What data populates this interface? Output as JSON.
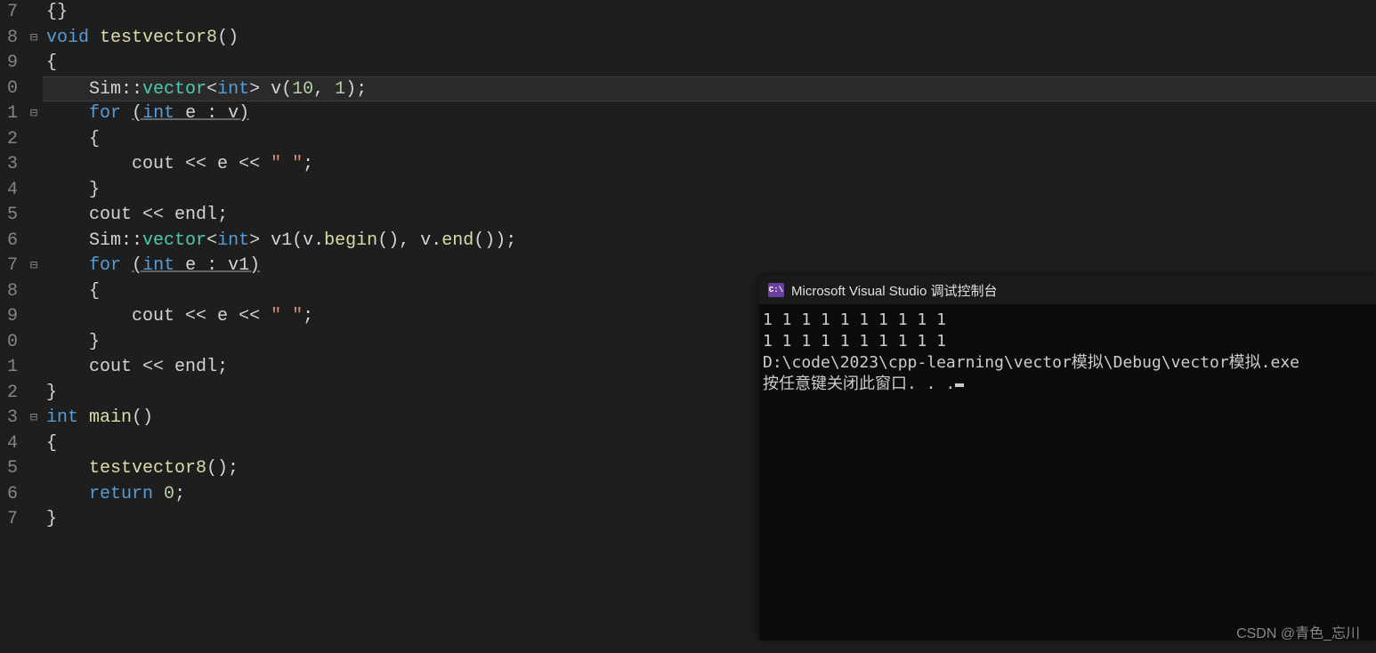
{
  "lineNumbers": [
    "7",
    "8",
    "9",
    "0",
    "1",
    "2",
    "3",
    "4",
    "5",
    "6",
    "7",
    "8",
    "9",
    "0",
    "1",
    "2",
    "3",
    "4",
    "5",
    "6",
    "7"
  ],
  "foldMarkers": [
    "",
    "⊟",
    "",
    "",
    "⊟",
    "",
    "",
    "",
    "",
    "",
    "⊟",
    "",
    "",
    "",
    "",
    "",
    "⊟",
    "",
    "",
    "",
    ""
  ],
  "code": [
    [
      {
        "t": "punct",
        "v": "{"
      },
      {
        "t": "punct",
        "v": "}"
      }
    ],
    [
      {
        "t": "kw",
        "v": "void"
      },
      {
        "t": "var",
        "v": " "
      },
      {
        "t": "fn",
        "v": "testvector8"
      },
      {
        "t": "punct",
        "v": "()"
      }
    ],
    [
      {
        "t": "punct",
        "v": "{"
      }
    ],
    [
      {
        "t": "var",
        "v": "    "
      },
      {
        "t": "var",
        "v": "Sim"
      },
      {
        "t": "punct",
        "v": "::"
      },
      {
        "t": "type",
        "v": "vector"
      },
      {
        "t": "punct",
        "v": "<"
      },
      {
        "t": "kw",
        "v": "int"
      },
      {
        "t": "punct",
        "v": "> "
      },
      {
        "t": "var",
        "v": "v"
      },
      {
        "t": "punct",
        "v": "("
      },
      {
        "t": "num",
        "v": "10"
      },
      {
        "t": "punct",
        "v": ", "
      },
      {
        "t": "num",
        "v": "1"
      },
      {
        "t": "punct",
        "v": ");"
      }
    ],
    [
      {
        "t": "var",
        "v": "    "
      },
      {
        "t": "kw",
        "v": "for"
      },
      {
        "t": "var",
        "v": " "
      },
      {
        "t": "punct paren-underline",
        "v": "("
      },
      {
        "t": "kw paren-underline",
        "v": "int"
      },
      {
        "t": "var paren-underline",
        "v": " e "
      },
      {
        "t": "punct paren-underline",
        "v": ":"
      },
      {
        "t": "var paren-underline",
        "v": " v"
      },
      {
        "t": "punct paren-underline",
        "v": ")"
      }
    ],
    [
      {
        "t": "var",
        "v": "    "
      },
      {
        "t": "punct",
        "v": "{"
      }
    ],
    [
      {
        "t": "var",
        "v": "        "
      },
      {
        "t": "var",
        "v": "cout "
      },
      {
        "t": "punct",
        "v": "<< "
      },
      {
        "t": "var",
        "v": "e "
      },
      {
        "t": "punct",
        "v": "<< "
      },
      {
        "t": "str",
        "v": "\" \""
      },
      {
        "t": "punct",
        "v": ";"
      }
    ],
    [
      {
        "t": "var",
        "v": "    "
      },
      {
        "t": "punct",
        "v": "}"
      }
    ],
    [
      {
        "t": "var",
        "v": "    "
      },
      {
        "t": "var",
        "v": "cout "
      },
      {
        "t": "punct",
        "v": "<< "
      },
      {
        "t": "var",
        "v": "endl"
      },
      {
        "t": "punct",
        "v": ";"
      }
    ],
    [
      {
        "t": "var",
        "v": "    "
      },
      {
        "t": "var",
        "v": "Sim"
      },
      {
        "t": "punct",
        "v": "::"
      },
      {
        "t": "type",
        "v": "vector"
      },
      {
        "t": "punct",
        "v": "<"
      },
      {
        "t": "kw",
        "v": "int"
      },
      {
        "t": "punct",
        "v": "> "
      },
      {
        "t": "var",
        "v": "v1"
      },
      {
        "t": "punct",
        "v": "("
      },
      {
        "t": "var",
        "v": "v"
      },
      {
        "t": "punct",
        "v": "."
      },
      {
        "t": "fn",
        "v": "begin"
      },
      {
        "t": "punct",
        "v": "(), "
      },
      {
        "t": "var",
        "v": "v"
      },
      {
        "t": "punct",
        "v": "."
      },
      {
        "t": "fn",
        "v": "end"
      },
      {
        "t": "punct",
        "v": "());"
      }
    ],
    [
      {
        "t": "var",
        "v": "    "
      },
      {
        "t": "kw",
        "v": "for"
      },
      {
        "t": "var",
        "v": " "
      },
      {
        "t": "punct paren-underline",
        "v": "("
      },
      {
        "t": "kw paren-underline",
        "v": "int"
      },
      {
        "t": "var paren-underline",
        "v": " e "
      },
      {
        "t": "punct paren-underline",
        "v": ":"
      },
      {
        "t": "var paren-underline",
        "v": " v1"
      },
      {
        "t": "punct paren-underline",
        "v": ")"
      }
    ],
    [
      {
        "t": "var",
        "v": "    "
      },
      {
        "t": "punct",
        "v": "{"
      }
    ],
    [
      {
        "t": "var",
        "v": "        "
      },
      {
        "t": "var",
        "v": "cout "
      },
      {
        "t": "punct",
        "v": "<< "
      },
      {
        "t": "var",
        "v": "e "
      },
      {
        "t": "punct",
        "v": "<< "
      },
      {
        "t": "str",
        "v": "\" \""
      },
      {
        "t": "punct",
        "v": ";"
      }
    ],
    [
      {
        "t": "var",
        "v": "    "
      },
      {
        "t": "punct",
        "v": "}"
      }
    ],
    [
      {
        "t": "var",
        "v": "    "
      },
      {
        "t": "var",
        "v": "cout "
      },
      {
        "t": "punct",
        "v": "<< "
      },
      {
        "t": "var",
        "v": "endl"
      },
      {
        "t": "punct",
        "v": ";"
      }
    ],
    [
      {
        "t": "punct",
        "v": "}"
      }
    ],
    [
      {
        "t": "kw",
        "v": "int"
      },
      {
        "t": "var",
        "v": " "
      },
      {
        "t": "fn",
        "v": "main"
      },
      {
        "t": "punct",
        "v": "()"
      }
    ],
    [
      {
        "t": "punct",
        "v": "{"
      }
    ],
    [
      {
        "t": "var",
        "v": "    "
      },
      {
        "t": "fn",
        "v": "testvector8"
      },
      {
        "t": "punct",
        "v": "();"
      }
    ],
    [
      {
        "t": "var",
        "v": "    "
      },
      {
        "t": "kw",
        "v": "return"
      },
      {
        "t": "var",
        "v": " "
      },
      {
        "t": "num",
        "v": "0"
      },
      {
        "t": "punct",
        "v": ";"
      }
    ],
    [
      {
        "t": "punct",
        "v": "}"
      }
    ]
  ],
  "highlightedLine": 3,
  "console": {
    "iconText": "C:\\",
    "title": "Microsoft Visual Studio 调试控制台",
    "lines": [
      "1 1 1 1 1 1 1 1 1 1",
      "1 1 1 1 1 1 1 1 1 1",
      "",
      "D:\\code\\2023\\cpp-learning\\vector模拟\\Debug\\vector模拟.exe",
      "按任意键关闭此窗口. . ."
    ]
  },
  "watermark": "CSDN @青色_忘川"
}
